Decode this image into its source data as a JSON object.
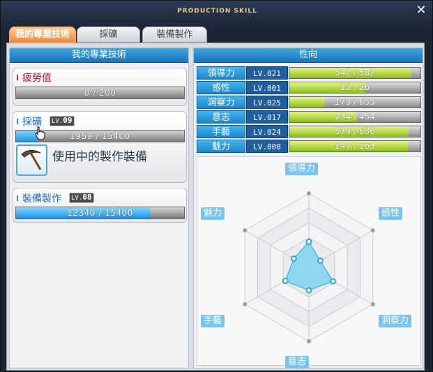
{
  "window": {
    "title": "PRODUCTION SKILL",
    "close_label": "✕"
  },
  "tabs": [
    {
      "label": "我的專業技術",
      "active": true
    },
    {
      "label": "採礦",
      "active": false
    },
    {
      "label": "裝備製作",
      "active": false
    }
  ],
  "left_panel": {
    "header": "我的專業技術",
    "fatigue": {
      "label": "疲勞值",
      "value_text": "0 / 200",
      "fraction": 0.0
    },
    "mining": {
      "label": "採礦",
      "lv_prefix": "LV.",
      "level": "09",
      "value_text": "1959 / 15400",
      "fraction": 0.127,
      "icon": "pickaxe-icon",
      "status_text": "使用中的製作裝備"
    },
    "crafting": {
      "label": "裝備製作",
      "lv_prefix": "LV.",
      "level": "08",
      "value_text": "12340 / 15400",
      "fraction": 0.801
    }
  },
  "right_panel": {
    "header": "性向",
    "traits": [
      {
        "name": "領導力",
        "lv": "LV.021",
        "value_text": "542 / 582",
        "fraction": 0.931
      },
      {
        "name": "感性",
        "lv": "LV.001",
        "value_text": "15 / 26",
        "fraction": 0.577
      },
      {
        "name": "洞察力",
        "lv": "LV.025",
        "value_text": "173 / 655",
        "fraction": 0.264
      },
      {
        "name": "意志",
        "lv": "LV.017",
        "value_text": "234 / 454",
        "fraction": 0.515
      },
      {
        "name": "手藝",
        "lv": "LV.024",
        "value_text": "579 / 636",
        "fraction": 0.91
      },
      {
        "name": "魅力",
        "lv": "LV.008",
        "value_text": "147 / 163",
        "fraction": 0.902
      }
    ],
    "radar": {
      "axes": [
        "領導力",
        "感性",
        "洞察力",
        "意志",
        "手藝",
        "魅力"
      ],
      "levels": [
        21,
        1,
        25,
        17,
        24,
        8
      ],
      "max_level": 100,
      "colors": {
        "grid": "#c9ccd0",
        "fill": "#7fd3ee",
        "stroke": "#2aa8d8",
        "label_bg": "#7cc4ee"
      }
    }
  },
  "colors": {
    "accent_blue": "#1b73bd",
    "tab_active": "#f08a3a",
    "bar_green": "#8cc014",
    "bar_blue": "#1e90e0"
  }
}
